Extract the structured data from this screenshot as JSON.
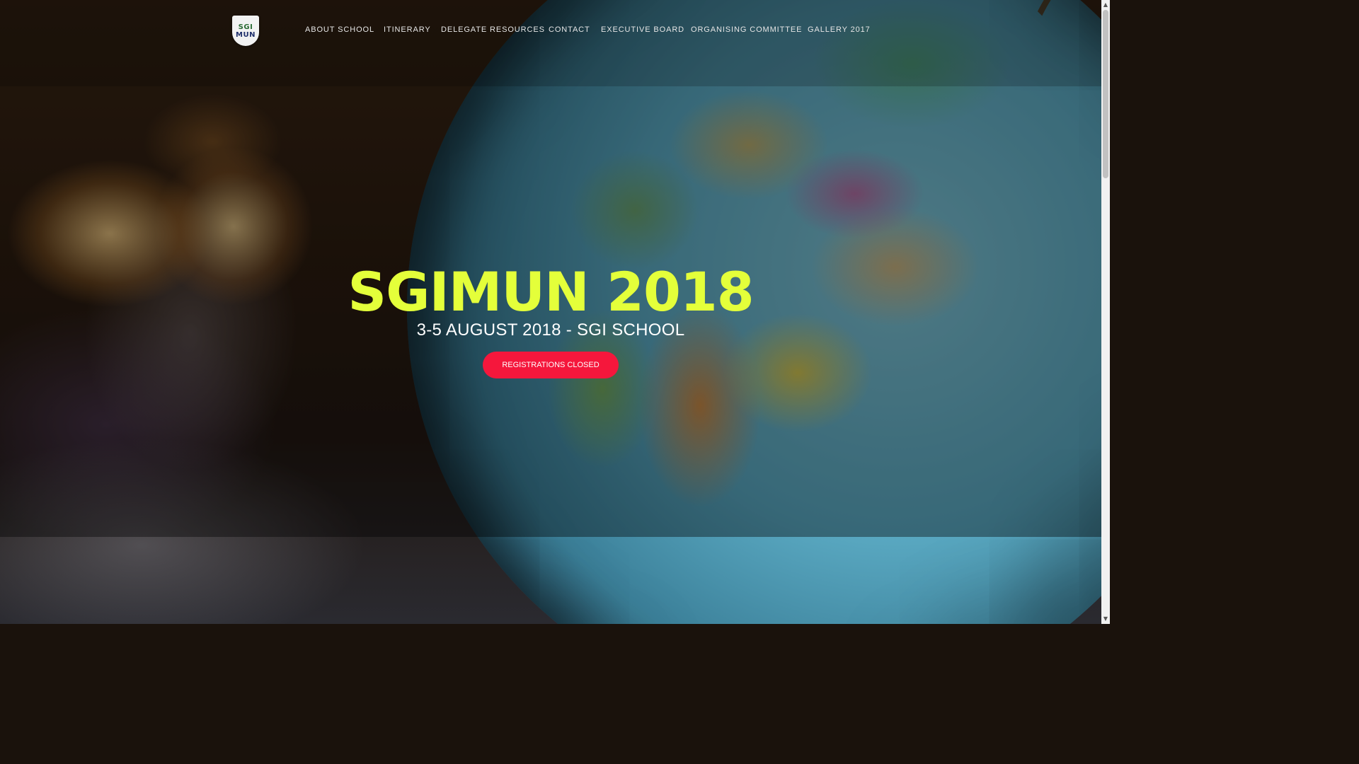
{
  "header": {
    "logo_text_top": "SGI",
    "logo_text_bottom": "MUN",
    "nav": [
      {
        "label": "ABOUT SCHOOL"
      },
      {
        "label": "ITINERARY"
      },
      {
        "label": "DELEGATE RESOURCES"
      },
      {
        "label": "CONTACT"
      },
      {
        "label": "EXECUTIVE BOARD"
      },
      {
        "label": "ORGANISING COMMITTEE"
      },
      {
        "label": "GALLERY 2017"
      }
    ]
  },
  "hero": {
    "title": "SGIMUN 2018",
    "subtitle": "3-5 AUGUST 2018 - SGI SCHOOL",
    "cta_label": "REGISTRATIONS CLOSED"
  },
  "colors": {
    "title": "#e4ff3a",
    "cta": "#f5173c"
  },
  "icons": {
    "scroll_up": "scroll-up-arrow-icon",
    "scroll_down": "scroll-down-arrow-icon"
  }
}
